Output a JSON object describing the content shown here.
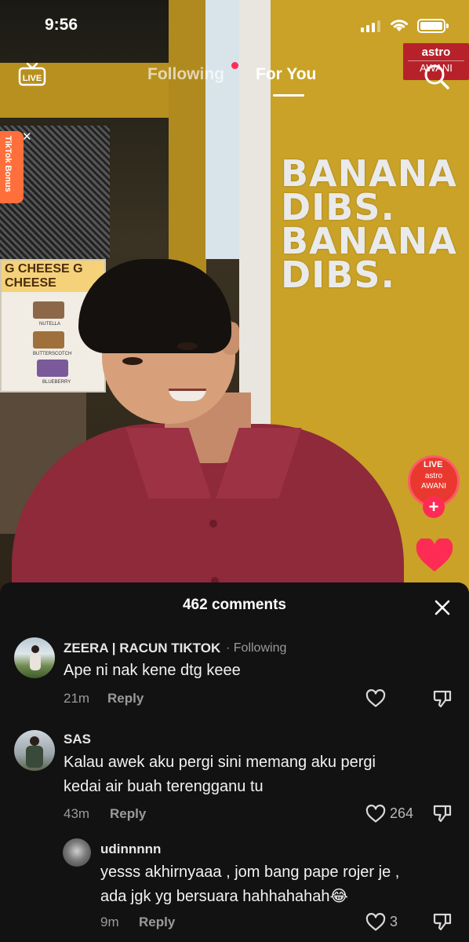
{
  "status_bar": {
    "time": "9:56"
  },
  "top_nav": {
    "live_label": "LIVE",
    "tabs": [
      {
        "label": "Following",
        "active": false,
        "has_notification_dot": true
      },
      {
        "label": "For You",
        "active": true
      }
    ]
  },
  "video": {
    "watermark": {
      "line1": "astro",
      "line2": "AWANI"
    },
    "bonus_tab": "TikTok Bonus",
    "menu_board": {
      "header": "G CHEESE G CHEESE",
      "items": [
        "NUTELLA",
        "BUTTERSCOTCH",
        "BLUEBERRY"
      ]
    },
    "wall_text": [
      "BANANA",
      "DIBS.",
      "BANANA",
      "DIBS."
    ],
    "creator_avatar": {
      "live": "LIVE",
      "line1": "astro",
      "line2": "AWANI"
    },
    "follow_plus": "+"
  },
  "comments_sheet": {
    "title": "462 comments",
    "comments": [
      {
        "username": "ZEERA | RACUN TIKTOK",
        "following": "· Following",
        "text": "Ape ni nak kene dtg keee",
        "time": "21m",
        "reply": "Reply",
        "likes": ""
      },
      {
        "username": "SAS",
        "text_lines": [
          "Kalau awek aku pergi sini memang aku pergi",
          "kedai air buah terengganu tu"
        ],
        "time": "43m",
        "reply": "Reply",
        "likes": "264"
      },
      {
        "username": "udinnnnn",
        "text_lines": [
          "yesss akhirnyaaa , jom bang pape rojer je ,",
          "ada jgk yg bersuara hahhahahah😂"
        ],
        "time": "9m",
        "reply": "Reply",
        "likes": "3"
      }
    ]
  },
  "colors": {
    "accent": "#fe2c55",
    "sheet_bg": "#121212",
    "brand_red": "#b7222a"
  }
}
